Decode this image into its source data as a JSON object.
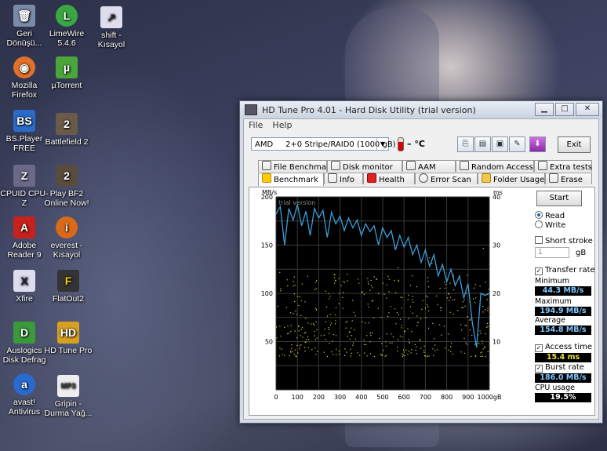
{
  "desktop": {
    "icons": [
      {
        "label": "Geri Dönüşü...",
        "icon": "recycle-bin-icon"
      },
      {
        "label": "LimeWire 5.4.6",
        "icon": "limewire-icon"
      },
      {
        "label": "shift - Kısayol",
        "icon": "shortcut-icon"
      },
      {
        "label": "Mozilla Firefox",
        "icon": "firefox-icon"
      },
      {
        "label": "µTorrent",
        "icon": "utorrent-icon"
      },
      {
        "label": "BS.Player FREE",
        "icon": "bsplayer-icon"
      },
      {
        "label": "Battlefield 2",
        "icon": "battlefield-icon"
      },
      {
        "label": "CPUID CPU-Z",
        "icon": "cpuz-icon"
      },
      {
        "label": "Play BF2 Online Now!",
        "icon": "bf2-icon"
      },
      {
        "label": "Adobe Reader 9",
        "icon": "adobe-reader-icon"
      },
      {
        "label": "everest - Kısayol",
        "icon": "everest-icon"
      },
      {
        "label": "Xfire",
        "icon": "xfire-icon"
      },
      {
        "label": "FlatOut2",
        "icon": "flatout-icon"
      },
      {
        "label": "Auslogics Disk Defrag",
        "icon": "auslogics-icon"
      },
      {
        "label": "HD Tune Pro",
        "icon": "hdtune-icon"
      },
      {
        "label": "avast! Antivirus",
        "icon": "avast-icon"
      },
      {
        "label": "Gripin - Durma Yağ...",
        "icon": "mp3-file-icon"
      }
    ]
  },
  "window": {
    "title": "HD Tune Pro 4.01 - Hard Disk Utility (trial version)",
    "controls": {
      "minimize": "▁",
      "maximize": "□",
      "close": "✕"
    },
    "menu": [
      "File",
      "Help"
    ],
    "drive_select": "AMD     2+0 Stripe/RAID0 (1000 gB)",
    "temperature": "– °C",
    "exit_label": "Exit",
    "tabs_row1": [
      "File Benchmark",
      "Disk monitor",
      "AAM",
      "Random Access",
      "Extra tests"
    ],
    "tabs_row2": [
      "Benchmark",
      "Info",
      "Health",
      "Error Scan",
      "Folder Usage",
      "Erase"
    ],
    "active_tab": "Benchmark"
  },
  "side": {
    "start_label": "Start",
    "read_label": "Read",
    "write_label": "Write",
    "mode": "Read",
    "short_stroke_label": "Short stroke",
    "short_stroke_checked": false,
    "short_stroke_value": "1",
    "short_stroke_unit": "gB",
    "transfer_rate_label": "Transfer rate",
    "transfer_rate_checked": true,
    "minimum_label": "Minimum",
    "minimum_value": "44.3 MB/s",
    "maximum_label": "Maximum",
    "maximum_value": "194.9 MB/s",
    "average_label": "Average",
    "average_value": "154.8 MB/s",
    "access_time_label": "Access time",
    "access_time_checked": true,
    "access_time_value": "15.4 ms",
    "burst_rate_label": "Burst rate",
    "burst_rate_checked": true,
    "burst_rate_value": "186.0 MB/s",
    "cpu_usage_label": "CPU usage",
    "cpu_usage_value": "19.5%"
  },
  "chart_data": {
    "type": "line",
    "watermark": "trial version",
    "ylabel_left": "MB/s",
    "ylabel_right": "ms",
    "xlabel": "gB",
    "xlim": [
      0,
      1000
    ],
    "ylim_left": [
      0,
      200
    ],
    "ylim_right": [
      0,
      40
    ],
    "x_ticks": [
      "0",
      "100",
      "200",
      "300",
      "400",
      "500",
      "600",
      "700",
      "800",
      "900",
      "1000gB"
    ],
    "y_ticks_left": [
      "200",
      "150",
      "100",
      "50"
    ],
    "y_ticks_right": [
      "40",
      "30",
      "20",
      "10"
    ],
    "grid": true,
    "colors": {
      "background": "#000000",
      "grid": "#3a3a3a",
      "transfer": "#3a9fd8",
      "access": "#d8d63a"
    },
    "series": [
      {
        "name": "Transfer rate",
        "x": [
          0,
          20,
          40,
          60,
          80,
          100,
          120,
          140,
          160,
          180,
          200,
          220,
          240,
          260,
          280,
          300,
          320,
          340,
          360,
          380,
          400,
          420,
          440,
          460,
          480,
          500,
          520,
          540,
          560,
          580,
          600,
          620,
          640,
          660,
          680,
          700,
          720,
          740,
          760,
          780,
          800,
          820,
          840,
          860,
          880,
          900,
          920,
          940,
          960,
          980,
          1000
        ],
        "values": [
          182,
          190,
          150,
          188,
          176,
          192,
          170,
          185,
          160,
          188,
          178,
          186,
          158,
          184,
          172,
          180,
          165,
          178,
          168,
          176,
          160,
          172,
          164,
          170,
          150,
          168,
          158,
          165,
          145,
          160,
          148,
          158,
          140,
          150,
          132,
          145,
          128,
          140,
          118,
          130,
          112,
          125,
          108,
          118,
          95,
          110,
          70,
          44,
          100,
          98,
          100
        ]
      },
      {
        "name": "Access time",
        "unit": "ms",
        "values_range": [
          7,
          30
        ],
        "note": "scatter points"
      }
    ]
  }
}
